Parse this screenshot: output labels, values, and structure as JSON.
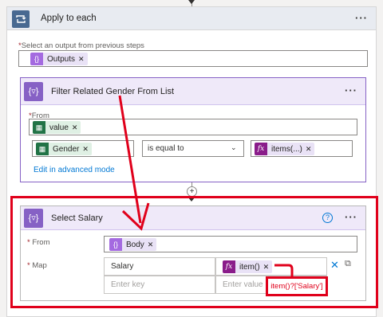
{
  "apply_to_each": {
    "title": "Apply to each",
    "more": "···",
    "select_label": "Select an output from previous steps",
    "token": "Outputs"
  },
  "filter": {
    "title": "Filter Related Gender From List",
    "more": "···",
    "from_label": "From",
    "from_token": "value",
    "left_token": "Gender",
    "operator": "is equal to",
    "right_token": "items(...)",
    "advanced_link": "Edit in advanced mode"
  },
  "select": {
    "title": "Select Salary",
    "help": "?",
    "more": "···",
    "from_label": "From",
    "from_token": "Body",
    "map_label": "Map",
    "map_key": "Salary",
    "map_value_token": "item()",
    "key_placeholder": "Enter key",
    "value_placeholder": "Enter value"
  },
  "annotation": {
    "expression": "item()?['Salary']"
  },
  "colors": {
    "highlight": "#e0001b",
    "accent": "#8661c5",
    "loop": "#486991"
  }
}
